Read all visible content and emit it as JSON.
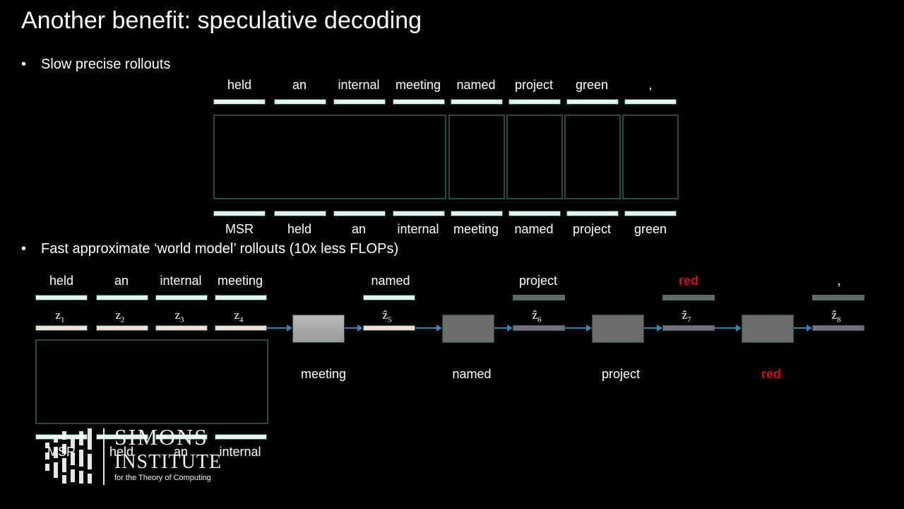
{
  "title": "Another benefit: speculative decoding",
  "bullets": {
    "slow": "Slow precise rollouts",
    "fast": "Fast approximate ‘world model’ rollouts (10x less FLOPs)"
  },
  "slow_rollout": {
    "outputs": [
      "held",
      "an",
      "internal",
      "meeting",
      "named",
      "project",
      "green",
      ","
    ],
    "inputs": [
      "MSR",
      "held",
      "an",
      "internal",
      "meeting",
      "named",
      "project",
      "green"
    ]
  },
  "fast_rollout": {
    "outputs_top": [
      "held",
      "an",
      "internal",
      "meeting"
    ],
    "latents": [
      "z",
      "z",
      "z",
      "z"
    ],
    "latent_subs": [
      "1",
      "2",
      "3",
      "4"
    ],
    "inputs": [
      "MSR",
      "held",
      "an",
      "internal"
    ],
    "spec_outputs": [
      "named",
      "project",
      "red",
      ","
    ],
    "spec_latents": [
      "ẑ",
      "ẑ",
      "ẑ",
      "ẑ"
    ],
    "spec_latent_subs": [
      "5",
      "6",
      "7",
      "8"
    ],
    "decoded": [
      "meeting",
      "named",
      "project",
      "red"
    ],
    "highlight_color": "#cc1111"
  },
  "logo": {
    "line1": "SIMONS",
    "line2": "INSTITUTE",
    "line3": "for the Theory of Computing"
  }
}
